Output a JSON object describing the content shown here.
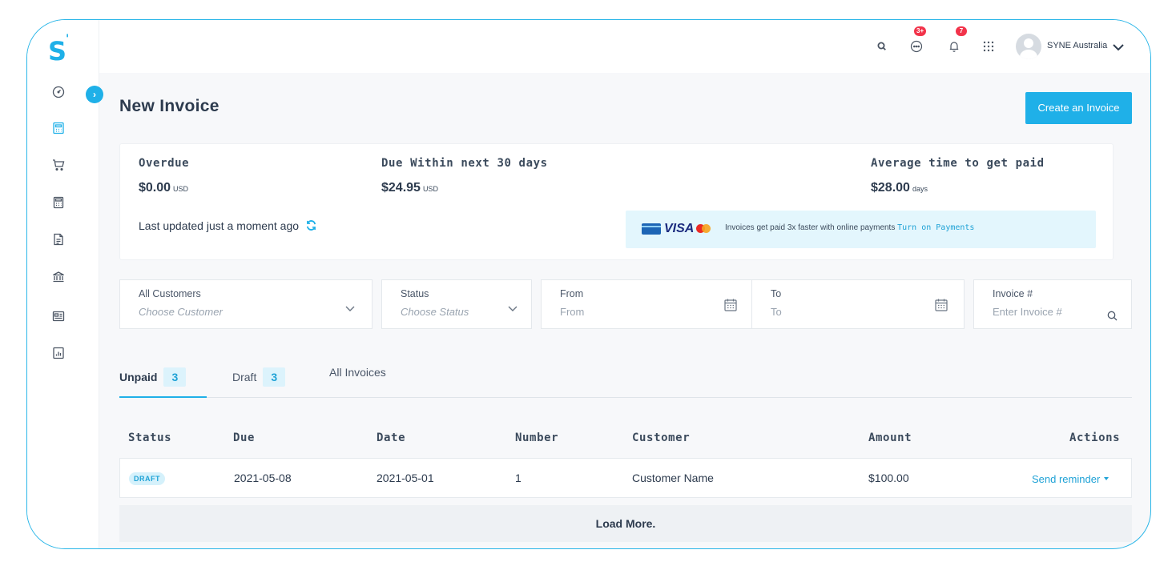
{
  "brand": {
    "logo_text": "S"
  },
  "header": {
    "messages_badge": "3+",
    "notifications_badge": "7",
    "user_name": "SYNE Australia"
  },
  "page": {
    "title": "New Invoice",
    "create_button": "Create an Invoice"
  },
  "summary": {
    "overdue_label": "Overdue",
    "overdue_value": "$0.00",
    "overdue_unit": "USD",
    "due_label": "Due Within next 30 days",
    "due_value": "$24.95",
    "due_unit": "USD",
    "avg_label": "Average time to get paid",
    "avg_value": "$28.00",
    "avg_unit": "days",
    "updated_text": "Last updated just a moment ago"
  },
  "payments": {
    "card_brand": "VISA",
    "message": "Invoices get paid 3x faster with online payments",
    "link": "Turn on Payments"
  },
  "filters": {
    "customers_label": "All Customers",
    "customers_placeholder": "Choose Customer",
    "status_label": "Status",
    "status_placeholder": "Choose Status",
    "from_label": "From",
    "from_placeholder": "From",
    "to_label": "To",
    "to_placeholder": "To",
    "invoice_label": "Invoice #",
    "invoice_placeholder": "Enter Invoice #"
  },
  "tabs": [
    {
      "label": "Unpaid",
      "count": "3"
    },
    {
      "label": "Draft",
      "count": "3"
    },
    {
      "label": "All Invoices",
      "count": ""
    }
  ],
  "table": {
    "headers": [
      "Status",
      "Due",
      "Date",
      "Number",
      "Customer",
      "Amount",
      "Actions"
    ],
    "rows": [
      {
        "status": "DRAFT",
        "due": "2021-05-08",
        "date": "2021-05-01",
        "number": "1",
        "customer": "Customer Name",
        "amount": "$100.00",
        "action": "Send reminder"
      }
    ],
    "load_more": "Load More."
  },
  "colors": {
    "accent": "#1fb0e8",
    "badge": "#f2334a",
    "frame": "#29b6e8"
  }
}
